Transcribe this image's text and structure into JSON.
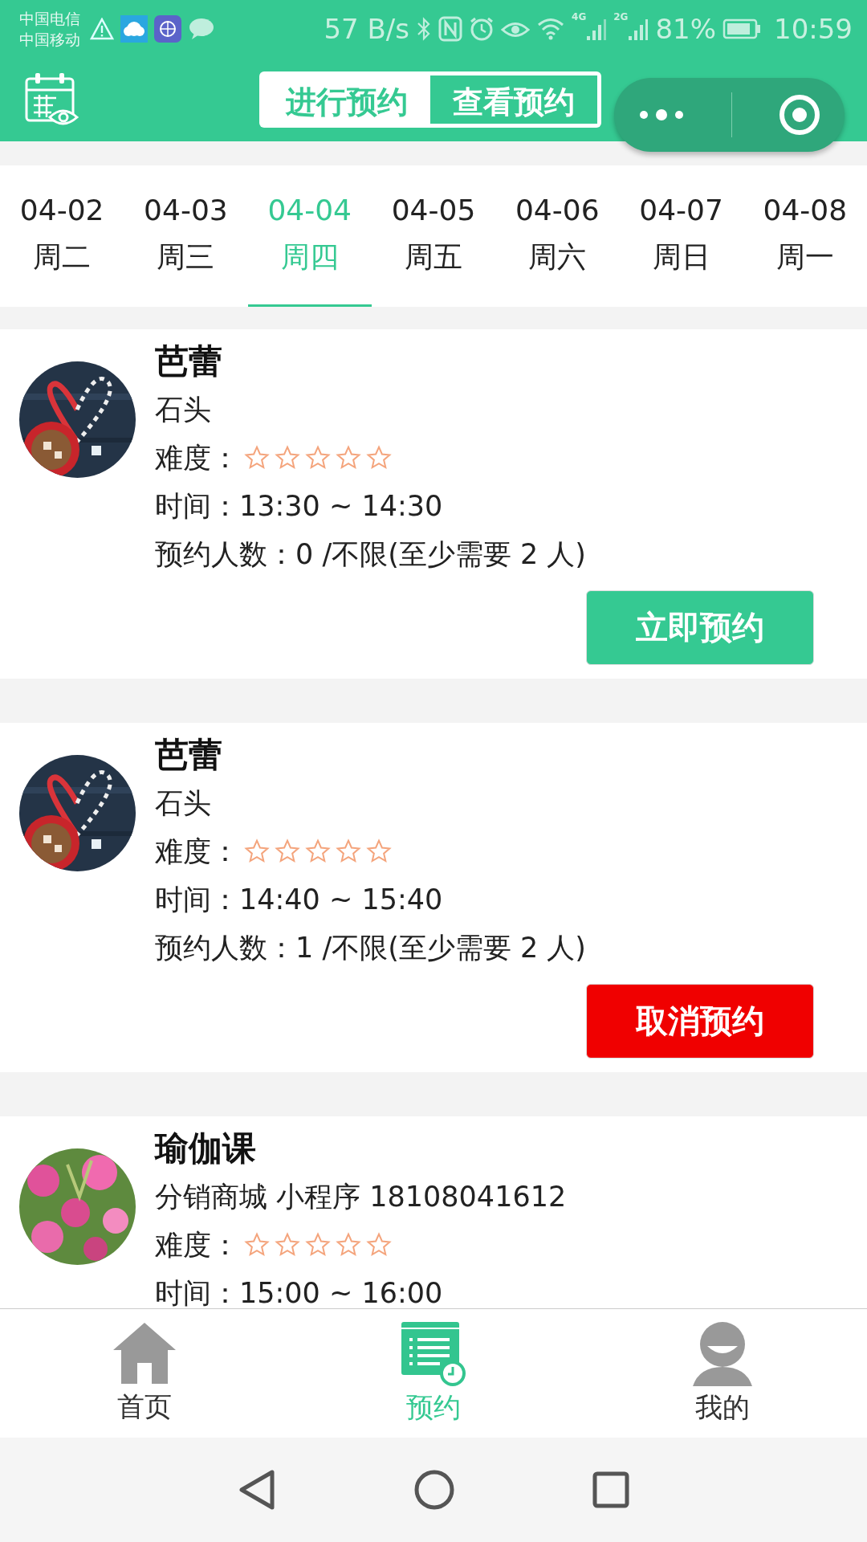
{
  "status_bar": {
    "carrier_1": "中国电信",
    "carrier_2": "中国移动",
    "speed": "57 B/s",
    "network_1": "4G",
    "network_2": "2G",
    "battery": "81%",
    "time": "10:59"
  },
  "header": {
    "segments": [
      {
        "label": "进行预约",
        "selected": false
      },
      {
        "label": "查看预约",
        "selected": true
      }
    ]
  },
  "dates": [
    {
      "date": "04-02",
      "weekday": "周二",
      "selected": false
    },
    {
      "date": "04-03",
      "weekday": "周三",
      "selected": false
    },
    {
      "date": "04-04",
      "weekday": "周四",
      "selected": true
    },
    {
      "date": "04-05",
      "weekday": "周五",
      "selected": false
    },
    {
      "date": "04-06",
      "weekday": "周六",
      "selected": false
    },
    {
      "date": "04-07",
      "weekday": "周日",
      "selected": false
    },
    {
      "date": "04-08",
      "weekday": "周一",
      "selected": false
    }
  ],
  "classes": [
    {
      "title": "芭蕾",
      "teacher": "石头",
      "difficulty_label": "难度：",
      "stars": 0,
      "time": "时间：13:30 ~ 14:30",
      "count": "预约人数：0 /不限(至少需要 2 人)",
      "button": {
        "kind": "book",
        "label": "立即预约"
      }
    },
    {
      "title": "芭蕾",
      "teacher": "石头",
      "difficulty_label": "难度：",
      "stars": 0,
      "time": "时间：14:40 ~ 15:40",
      "count": "预约人数：1 /不限(至少需要 2 人)",
      "button": {
        "kind": "cancel",
        "label": "取消预约"
      }
    },
    {
      "title": "瑜伽课",
      "teacher": "分销商城 小程序 18108041612",
      "difficulty_label": "难度：",
      "stars": 0,
      "time": "时间：15:00 ~ 16:00"
    }
  ],
  "tab_bar": [
    {
      "label": "首页",
      "selected": false
    },
    {
      "label": "预约",
      "selected": true
    },
    {
      "label": "我的",
      "selected": false
    }
  ]
}
